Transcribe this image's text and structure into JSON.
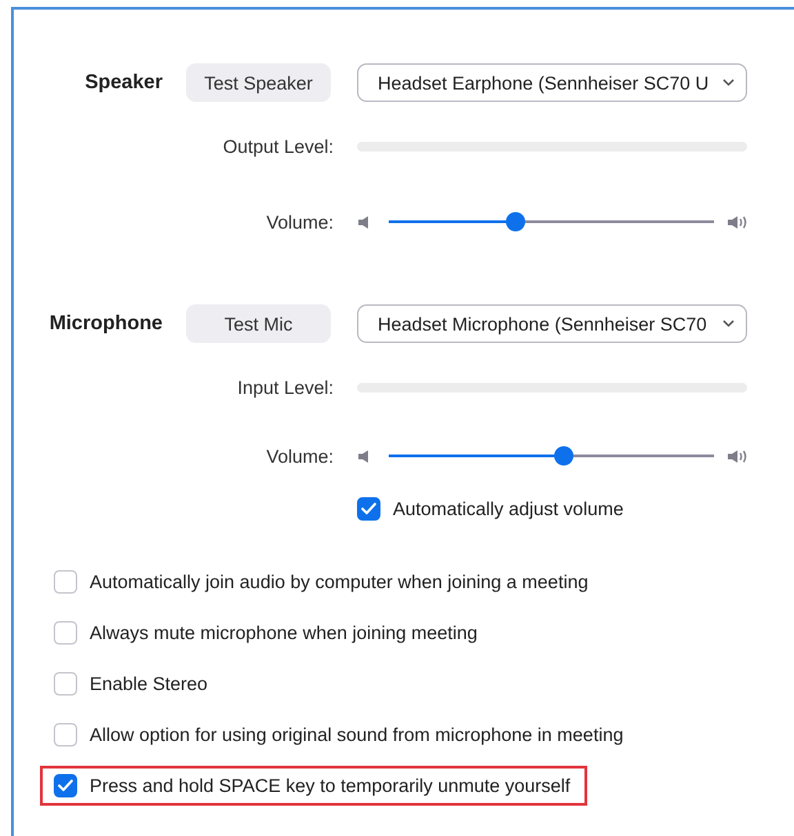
{
  "sections": [
    {
      "label": "Speaker",
      "test_button": "Test Speaker",
      "device": "Headset Earphone (Sennheiser SC70 U",
      "level_label": "Output Level:",
      "level": 0,
      "volume_label": "Volume:",
      "volume": {
        "level": 0.39
      }
    },
    {
      "label": "Microphone",
      "test_button": "Test Mic",
      "device": "Headset Microphone (Sennheiser SC70",
      "level_label": "Input Level:",
      "level": 0,
      "volume_label": "Volume:",
      "volume": {
        "level": 0.54
      },
      "auto_adjust": {
        "label": "Automatically adjust volume",
        "checked": true
      }
    }
  ],
  "options": [
    {
      "label": "Automatically join audio by computer when joining a meeting",
      "checked": false,
      "highlighted": false
    },
    {
      "label": "Always mute microphone when joining meeting",
      "checked": false,
      "highlighted": false
    },
    {
      "label": "Enable Stereo",
      "checked": false,
      "highlighted": false
    },
    {
      "label": "Allow option for using original sound from microphone in meeting",
      "checked": false,
      "highlighted": false
    },
    {
      "label": "Press and hold SPACE key to temporarily unmute yourself",
      "checked": true,
      "highlighted": true
    }
  ]
}
